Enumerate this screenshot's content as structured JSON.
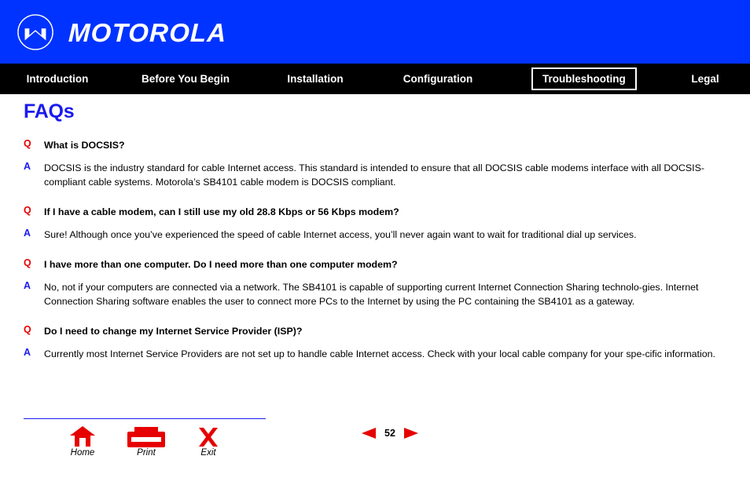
{
  "header": {
    "brand": "MOTOROLA",
    "logo_icon": "motorola-batwing-logo",
    "background_color": "#0033ff"
  },
  "nav": {
    "background_color": "#000000",
    "active_item": "Troubleshooting",
    "items": [
      {
        "label": "Introduction",
        "active": false
      },
      {
        "label": "Before You Begin",
        "active": false
      },
      {
        "label": "Installation",
        "active": false
      },
      {
        "label": "Configuration",
        "active": false
      },
      {
        "label": "Troubleshooting",
        "active": true
      },
      {
        "label": "Legal",
        "active": false
      }
    ]
  },
  "main": {
    "title": "FAQs",
    "title_color": "#1a1aee",
    "q_marker": "Q",
    "a_marker": "A",
    "q_color": "#e60000",
    "a_color": "#1a1aee",
    "faqs": [
      {
        "question": "What is DOCSIS?",
        "answer": "DOCSIS is the industry standard for cable Internet access. This standard is intended to ensure that all DOCSIS cable modems interface with all DOCSIS-compliant cable systems. Motorola’s SB4101 cable modem is DOCSIS compliant."
      },
      {
        "question": "If I have a cable modem, can I still use my old 28.8 Kbps or 56 Kbps modem?",
        "answer": "Sure! Although once you’ve experienced the speed of cable Internet access, you’ll never again want to wait for traditional dial up services."
      },
      {
        "question": "I have more than one computer. Do I need more than one computer modem?",
        "answer": "No, not if your computers are connected via a network. The SB4101 is capable of supporting current Internet Connection Sharing technolo-gies. Internet Connection Sharing software enables the user to connect more PCs to the Internet by using the PC containing the SB4101 as a gateway."
      },
      {
        "question": "Do I need to change my Internet Service Provider (ISP)?",
        "answer": "Currently most Internet Service Providers are not set up to handle cable Internet access. Check with your local cable company for your spe-cific information."
      }
    ]
  },
  "footer": {
    "divider_color": "#1a1aee",
    "icon_color": "#e60000",
    "buttons": [
      {
        "label": "Home",
        "icon": "home-icon"
      },
      {
        "label": "Print",
        "icon": "printer-icon"
      },
      {
        "label": "Exit",
        "icon": "close-x-icon"
      }
    ],
    "pager": {
      "prev_icon": "triangle-left-icon",
      "next_icon": "triangle-right-icon",
      "page_number": "52"
    }
  }
}
